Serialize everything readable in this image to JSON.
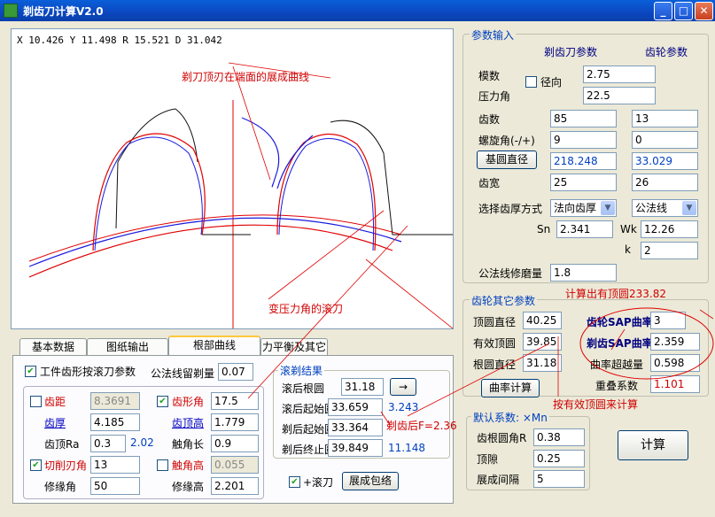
{
  "window": {
    "title": "剃齿刀计算V2.0",
    "min": "_",
    "max": "□",
    "close": "✕"
  },
  "canvas": {
    "coord": "X 10.426 Y 11.498  R 15.521 D 31.042",
    "label_top": "剃刀顶刃在端面的展成曲线",
    "label_bottom": "变压力角的滚刀"
  },
  "params": {
    "title": "参数输入",
    "col_cutter": "剃齿刀参数",
    "col_gear": "齿轮参数",
    "module_label": "模数",
    "radial_label": "径向",
    "module": "2.75",
    "pressure_label": "压力角",
    "pressure": "22.5",
    "teeth_label": "齿数",
    "teeth_cutter": "85",
    "teeth_gear": "13",
    "helix_label": "螺旋角(-/+)",
    "helix_cutter": "9",
    "helix_gear": "0",
    "base_btn": "基圆直径",
    "base_cutter": "218.248",
    "base_gear": "33.029",
    "width_label": "齿宽",
    "width_cutter": "25",
    "width_gear": "26",
    "thickness_label": "选择齿厚方式",
    "thickness_mode": "法向齿厚",
    "thickness_mode2": "公法线",
    "sn_label": "Sn",
    "sn": "2.341",
    "wk_label": "Wk",
    "wk": "12.26",
    "k_label": "k",
    "k": "2",
    "grind_label": "公法线修磨量",
    "grind": "1.8"
  },
  "gear_other": {
    "title": "齿轮其它参数",
    "note": "计算出有顶圆233.82",
    "tip_label": "顶圆直径",
    "tip": "40.25",
    "eff_label": "有效顶圆",
    "eff": "39.85",
    "root_label": "根圆直径",
    "root": "31.18",
    "curv_btn": "曲率计算",
    "gear_sap_label": "齿轮SAP曲率",
    "gear_sap": "3",
    "shave_sap_label": "剃齿SAP曲率",
    "shave_sap": "2.359",
    "over_label": "曲率超越量",
    "over": "0.598",
    "overlap_label": "重叠系数",
    "overlap": "1.101",
    "note2": "按有效顶圆来计算"
  },
  "defaults": {
    "title": "默认系数: ×Mn",
    "r_label": "齿根圆角R",
    "r": "0.38",
    "clear_label": "顶隙",
    "clear": "0.25",
    "gap_label": "展成间隔",
    "gap": "5"
  },
  "calc_btn": "计算",
  "tabs": [
    "基本数据",
    "图纸输出",
    "根部曲线",
    "力平衡及其它"
  ],
  "tab_root": {
    "shape_cb": "工件齿形按滚刀参数",
    "grind_left_label": "公法线留剃量",
    "grind_left": "0.07",
    "pitch_label": "齿距",
    "pitch": "8.3691",
    "angle_label": "齿形角",
    "angle": "17.5",
    "thick_label": "齿厚",
    "thick": "4.185",
    "height_label": "齿顶高",
    "height": "1.779",
    "tip_ra_label": "齿顶Ra",
    "tip_ra": "0.3",
    "tip_ra_val": "2.02",
    "contact_len_label": "触角长",
    "contact_len": "0.9",
    "cut_label": "切削刃角",
    "cut": "13",
    "contact_h_label": "触角高",
    "contact_h": "0.055",
    "edge_angle_label": "修缘角",
    "edge_angle": "50",
    "edge_h_label": "修缘高",
    "edge_h": "2.201",
    "hob_cb": "+滚刀",
    "env_btn": "展成包络"
  },
  "roll_result": {
    "title": "滚剃结果",
    "r1_label": "滚后根圆",
    "r1": "31.18",
    "arrow": "→",
    "r2_label": "滚后起始圆",
    "r2": "33.659",
    "r2v": "3.243",
    "r3_label": "剃后起始圆",
    "r3": "33.364",
    "r3note": "剃齿后F=2.36",
    "r4_label": "剃后终止圆",
    "r4": "39.849",
    "r4v": "11.148"
  }
}
